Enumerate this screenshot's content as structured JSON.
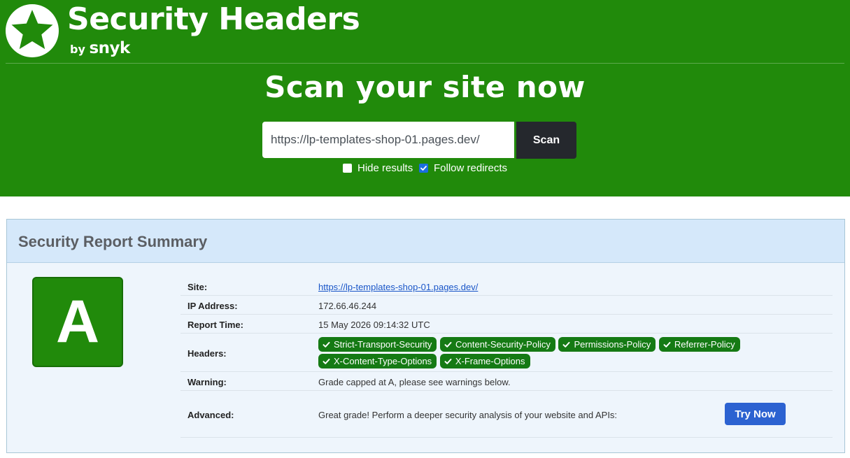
{
  "brand": {
    "title": "Security Headers",
    "by": "by",
    "company": "snyk",
    "icon": "star-icon"
  },
  "scan": {
    "heading": "Scan your site now",
    "url_value": "https://lp-templates-shop-01.pages.dev/",
    "button_label": "Scan",
    "hide_results_label": "Hide results",
    "hide_results_checked": false,
    "follow_redirects_label": "Follow redirects",
    "follow_redirects_checked": true
  },
  "report": {
    "title": "Security Report Summary",
    "grade": "A",
    "grade_color": "#218a0b",
    "rows": {
      "site_label": "Site:",
      "site_value": "https://lp-templates-shop-01.pages.dev/",
      "ip_label": "IP Address:",
      "ip_value": "172.66.46.244",
      "time_label": "Report Time:",
      "time_value": "15 May 2026 09:14:32 UTC",
      "headers_label": "Headers:",
      "warning_label": "Warning:",
      "warning_value": "Grade capped at A, please see warnings below.",
      "advanced_label": "Advanced:",
      "advanced_value": "Great grade! Perform a deeper security analysis of your website and APIs:"
    },
    "headers": [
      "Strict-Transport-Security",
      "Content-Security-Policy",
      "Permissions-Policy",
      "Referrer-Policy",
      "X-Content-Type-Options",
      "X-Frame-Options"
    ],
    "try_now_label": "Try Now"
  },
  "colors": {
    "hero_green": "#218a0b",
    "pill_green": "#157a14",
    "scan_button": "#25282d",
    "try_button": "#2c62d1",
    "panel_header": "#d5e8fa"
  }
}
